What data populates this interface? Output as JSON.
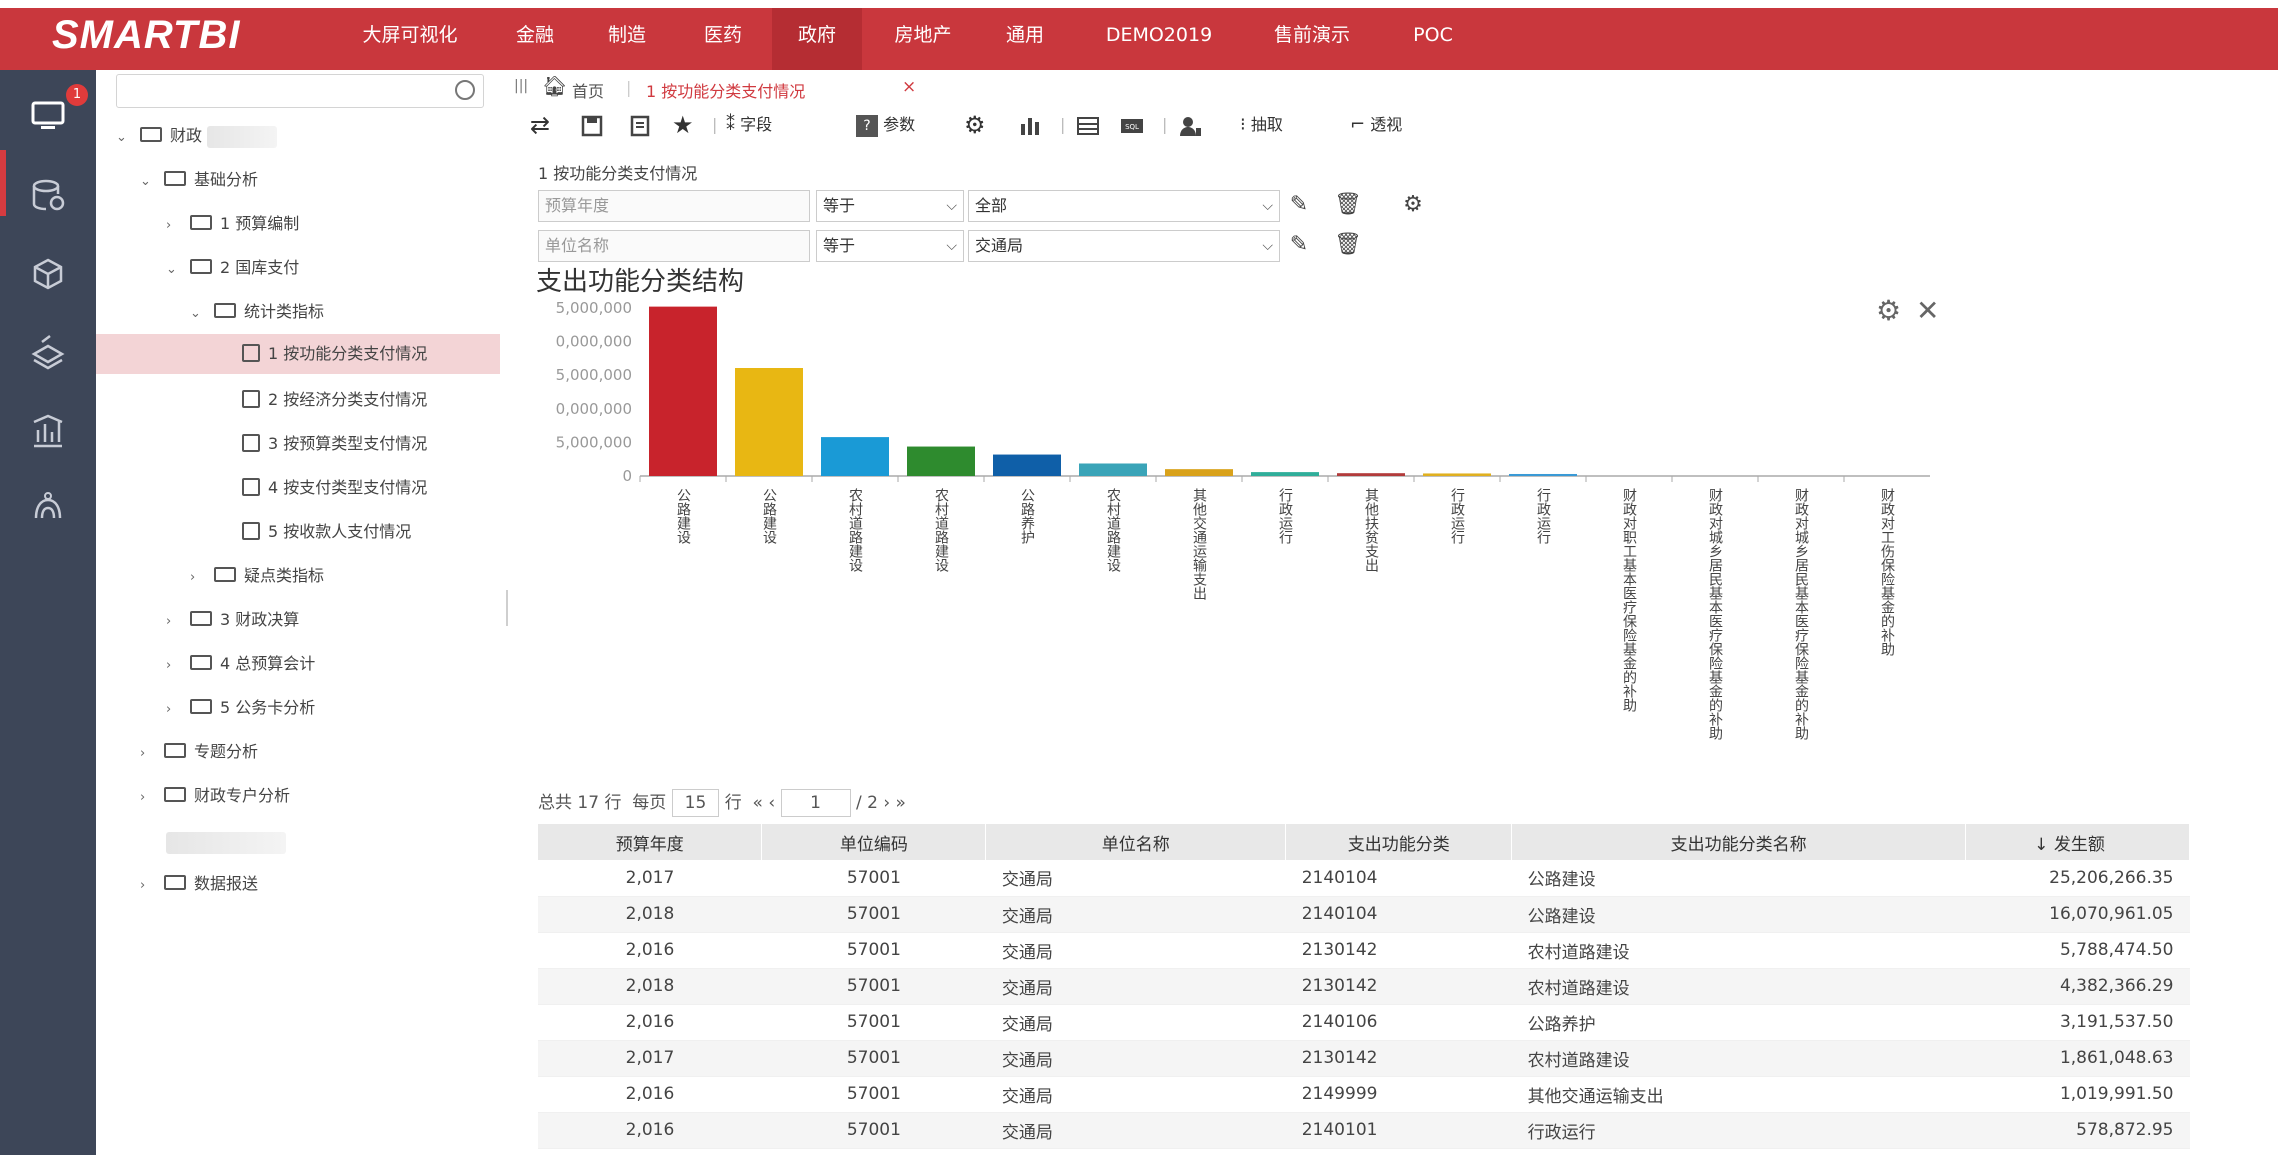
{
  "header": {
    "logo": "SMARTBI",
    "nav": [
      {
        "label": "大屏可视化",
        "active": false
      },
      {
        "label": "金融",
        "active": false
      },
      {
        "label": "制造",
        "active": false
      },
      {
        "label": "医药",
        "active": false
      },
      {
        "label": "政府",
        "active": true
      },
      {
        "label": "房地产",
        "active": false
      },
      {
        "label": "通用",
        "active": false
      },
      {
        "label": "DEMO2019",
        "active": false
      },
      {
        "label": "售前演示",
        "active": false
      },
      {
        "label": "POC",
        "active": false
      }
    ],
    "accent_color": "#c9373d"
  },
  "rail": {
    "badge": "1",
    "icons": [
      "monitor-icon",
      "database-icon",
      "cube-icon",
      "layers-icon",
      "chart-icon",
      "cluster-icon"
    ]
  },
  "tree": {
    "search_placeholder": "",
    "nodes": [
      {
        "label": "财政",
        "arrow": "⌄",
        "icon": "folder"
      },
      {
        "label": "基础分析",
        "arrow": "⌄",
        "icon": "folder"
      },
      {
        "label": "1 预算编制",
        "arrow": "›",
        "icon": "folder"
      },
      {
        "label": "2 国库支付",
        "arrow": "⌄",
        "icon": "folder"
      },
      {
        "label": "统计类指标",
        "arrow": "⌄",
        "icon": "folder"
      },
      {
        "label": "1 按功能分类支付情况",
        "arrow": "",
        "icon": "report"
      },
      {
        "label": "2 按经济分类支付情况",
        "arrow": "",
        "icon": "report"
      },
      {
        "label": "3 按预算类型支付情况",
        "arrow": "",
        "icon": "pivot"
      },
      {
        "label": "4 按支付类型支付情况",
        "arrow": "",
        "icon": "pivot"
      },
      {
        "label": "5 按收款人支付情况",
        "arrow": "",
        "icon": "pivot"
      },
      {
        "label": "疑点类指标",
        "arrow": "›",
        "icon": "folder"
      },
      {
        "label": "3 财政决算",
        "arrow": "›",
        "icon": "folder"
      },
      {
        "label": "4 总预算会计",
        "arrow": "›",
        "icon": "folder"
      },
      {
        "label": "5 公务卡分析",
        "arrow": "›",
        "icon": "folder"
      },
      {
        "label": "专题分析",
        "arrow": "›",
        "icon": "folder"
      },
      {
        "label": "财政专户分析",
        "arrow": "›",
        "icon": "folder"
      },
      {
        "label": "数据报送",
        "arrow": "›",
        "icon": "folder"
      }
    ]
  },
  "tabs": {
    "home": "首页",
    "active": "1 按功能分类支付情况"
  },
  "toolbar": {
    "fields": "字段",
    "params": "参数",
    "extract": "抽取",
    "pivot": "透视"
  },
  "report": {
    "title": "1 按功能分类支付情况",
    "filters": [
      {
        "label": "预算年度",
        "op": "等于",
        "value": "全部"
      },
      {
        "label": "单位名称",
        "op": "等于",
        "value": "交通局"
      }
    ]
  },
  "chart_data": {
    "type": "bar",
    "title": "支出功能分类结构",
    "ytick_labels": [
      "0",
      "5,000,000",
      "0,000,000",
      "5,000,000",
      "0,000,000",
      "5,000,000"
    ],
    "ylim": [
      0,
      25000000
    ],
    "categories": [
      "公路建设",
      "公路建设",
      "农村道路建设",
      "农村道路建设",
      "公路养护",
      "农村道路建设",
      "其他交通运输支出",
      "行政运行",
      "其他扶贫支出",
      "行政运行",
      "行政运行",
      "财政对职工基本医疗保险基金的补助",
      "财政对城乡居民基本医疗保险基金的补助",
      "财政对城乡居民基本医疗保险基金的补助",
      "财政对工伤保险基金的补助"
    ],
    "values": [
      25206266.35,
      16070961.05,
      5788474.5,
      4382366.29,
      3191537.5,
      1861048.63,
      1019991.5,
      578872.95,
      420000,
      380000,
      300000,
      0,
      0,
      0,
      0
    ],
    "colors": [
      "#c8232c",
      "#e8b713",
      "#1a9ad6",
      "#2e8b2e",
      "#0f5fa8",
      "#3aa4b8",
      "#d9a21b",
      "#2fae9a",
      "#b23b3b",
      "#e0b020",
      "#3a9ad6",
      "#999999",
      "#999999",
      "#999999",
      "#999999"
    ]
  },
  "pager": {
    "total_prefix": "总共",
    "total": "17",
    "rows_unit": "行",
    "per_page_label": "每页",
    "per_page": "15",
    "per_page_unit": "行",
    "first": "«",
    "prev": "‹",
    "page": "1",
    "pages": "/ 2",
    "next": "›",
    "last": "»"
  },
  "table": {
    "headers": [
      "预算年度",
      "单位编码",
      "单位名称",
      "支出功能分类",
      "支出功能分类名称",
      "↓ 发生额"
    ],
    "rows": [
      [
        "2,017",
        "57001",
        "交通局",
        "2140104",
        "公路建设",
        "25,206,266.35"
      ],
      [
        "2,018",
        "57001",
        "交通局",
        "2140104",
        "公路建设",
        "16,070,961.05"
      ],
      [
        "2,016",
        "57001",
        "交通局",
        "2130142",
        "农村道路建设",
        "5,788,474.50"
      ],
      [
        "2,018",
        "57001",
        "交通局",
        "2130142",
        "农村道路建设",
        "4,382,366.29"
      ],
      [
        "2,016",
        "57001",
        "交通局",
        "2140106",
        "公路养护",
        "3,191,537.50"
      ],
      [
        "2,017",
        "57001",
        "交通局",
        "2130142",
        "农村道路建设",
        "1,861,048.63"
      ],
      [
        "2,016",
        "57001",
        "交通局",
        "2149999",
        "其他交通运输支出",
        "1,019,991.50"
      ],
      [
        "2,016",
        "57001",
        "交通局",
        "2140101",
        "行政运行",
        "578,872.95"
      ]
    ]
  }
}
